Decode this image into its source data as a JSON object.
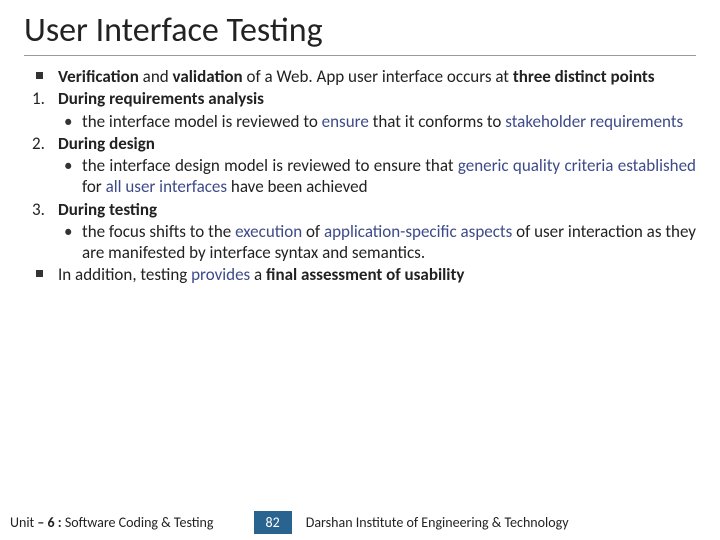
{
  "title": "User Interface Testing",
  "b0a": "Verification",
  "b0b": " and ",
  "b0c": "validation",
  "b0d": " of a Web. App user interface occurs at ",
  "b0e": "three distinct points",
  "n1": "1.",
  "t1": "During requirements analysis",
  "s1a": "the interface model is reviewed to ",
  "s1b": "ensure",
  "s1c": " that it conforms to ",
  "s1d": "stakeholder requirements",
  "n2": "2.",
  "t2": "During design",
  "s2a": "the interface design model is reviewed to ensure that ",
  "s2b": "generic quality criteria established",
  "s2c": " for ",
  "s2d": "all user interfaces",
  "s2e": " have been achieved",
  "n3": "3.",
  "t3": "During testing",
  "s3a": "the focus shifts to the ",
  "s3b": "execution",
  "s3c": " of ",
  "s3d": "application-specific aspects ",
  "s3e": "of user interaction as they are manifested by interface syntax and semantics.",
  "b4a": "In addition, testing ",
  "b4b": "provides",
  "b4c": " a ",
  "b4d": "final assessment of usability",
  "footer_unit_pre": "Unit ",
  "footer_unit_b": "– 6 :",
  "footer_unit_post": " Software Coding & Testing",
  "page": "82",
  "institute": "Darshan Institute of Engineering & Technology"
}
